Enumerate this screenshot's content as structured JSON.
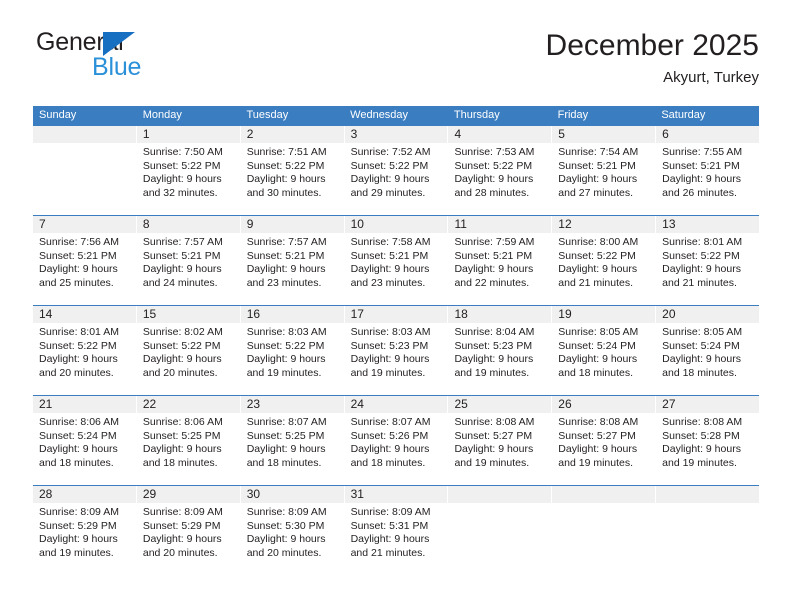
{
  "brand": {
    "name_part1": "General",
    "name_part2": "Blue",
    "accent_color": "#176fc1",
    "blue_text_color": "#2a90d8"
  },
  "header": {
    "title": "December 2025",
    "subtitle": "Akyurt, Turkey"
  },
  "theme": {
    "header_row_bg": "#3a7dc0",
    "day_number_bg": "#f0f0f0",
    "grid_line": "#3a7dc0",
    "text": "#231f20"
  },
  "weekdays": [
    "Sunday",
    "Monday",
    "Tuesday",
    "Wednesday",
    "Thursday",
    "Friday",
    "Saturday"
  ],
  "weeks": [
    [
      {
        "day": "",
        "sunrise": "",
        "sunset": "",
        "daylight": "",
        "empty": true
      },
      {
        "day": "1",
        "sunrise": "Sunrise: 7:50 AM",
        "sunset": "Sunset: 5:22 PM",
        "daylight": "Daylight: 9 hours and 32 minutes."
      },
      {
        "day": "2",
        "sunrise": "Sunrise: 7:51 AM",
        "sunset": "Sunset: 5:22 PM",
        "daylight": "Daylight: 9 hours and 30 minutes."
      },
      {
        "day": "3",
        "sunrise": "Sunrise: 7:52 AM",
        "sunset": "Sunset: 5:22 PM",
        "daylight": "Daylight: 9 hours and 29 minutes."
      },
      {
        "day": "4",
        "sunrise": "Sunrise: 7:53 AM",
        "sunset": "Sunset: 5:22 PM",
        "daylight": "Daylight: 9 hours and 28 minutes."
      },
      {
        "day": "5",
        "sunrise": "Sunrise: 7:54 AM",
        "sunset": "Sunset: 5:21 PM",
        "daylight": "Daylight: 9 hours and 27 minutes."
      },
      {
        "day": "6",
        "sunrise": "Sunrise: 7:55 AM",
        "sunset": "Sunset: 5:21 PM",
        "daylight": "Daylight: 9 hours and 26 minutes."
      }
    ],
    [
      {
        "day": "7",
        "sunrise": "Sunrise: 7:56 AM",
        "sunset": "Sunset: 5:21 PM",
        "daylight": "Daylight: 9 hours and 25 minutes."
      },
      {
        "day": "8",
        "sunrise": "Sunrise: 7:57 AM",
        "sunset": "Sunset: 5:21 PM",
        "daylight": "Daylight: 9 hours and 24 minutes."
      },
      {
        "day": "9",
        "sunrise": "Sunrise: 7:57 AM",
        "sunset": "Sunset: 5:21 PM",
        "daylight": "Daylight: 9 hours and 23 minutes."
      },
      {
        "day": "10",
        "sunrise": "Sunrise: 7:58 AM",
        "sunset": "Sunset: 5:21 PM",
        "daylight": "Daylight: 9 hours and 23 minutes."
      },
      {
        "day": "11",
        "sunrise": "Sunrise: 7:59 AM",
        "sunset": "Sunset: 5:21 PM",
        "daylight": "Daylight: 9 hours and 22 minutes."
      },
      {
        "day": "12",
        "sunrise": "Sunrise: 8:00 AM",
        "sunset": "Sunset: 5:22 PM",
        "daylight": "Daylight: 9 hours and 21 minutes."
      },
      {
        "day": "13",
        "sunrise": "Sunrise: 8:01 AM",
        "sunset": "Sunset: 5:22 PM",
        "daylight": "Daylight: 9 hours and 21 minutes."
      }
    ],
    [
      {
        "day": "14",
        "sunrise": "Sunrise: 8:01 AM",
        "sunset": "Sunset: 5:22 PM",
        "daylight": "Daylight: 9 hours and 20 minutes."
      },
      {
        "day": "15",
        "sunrise": "Sunrise: 8:02 AM",
        "sunset": "Sunset: 5:22 PM",
        "daylight": "Daylight: 9 hours and 20 minutes."
      },
      {
        "day": "16",
        "sunrise": "Sunrise: 8:03 AM",
        "sunset": "Sunset: 5:22 PM",
        "daylight": "Daylight: 9 hours and 19 minutes."
      },
      {
        "day": "17",
        "sunrise": "Sunrise: 8:03 AM",
        "sunset": "Sunset: 5:23 PM",
        "daylight": "Daylight: 9 hours and 19 minutes."
      },
      {
        "day": "18",
        "sunrise": "Sunrise: 8:04 AM",
        "sunset": "Sunset: 5:23 PM",
        "daylight": "Daylight: 9 hours and 19 minutes."
      },
      {
        "day": "19",
        "sunrise": "Sunrise: 8:05 AM",
        "sunset": "Sunset: 5:24 PM",
        "daylight": "Daylight: 9 hours and 18 minutes."
      },
      {
        "day": "20",
        "sunrise": "Sunrise: 8:05 AM",
        "sunset": "Sunset: 5:24 PM",
        "daylight": "Daylight: 9 hours and 18 minutes."
      }
    ],
    [
      {
        "day": "21",
        "sunrise": "Sunrise: 8:06 AM",
        "sunset": "Sunset: 5:24 PM",
        "daylight": "Daylight: 9 hours and 18 minutes."
      },
      {
        "day": "22",
        "sunrise": "Sunrise: 8:06 AM",
        "sunset": "Sunset: 5:25 PM",
        "daylight": "Daylight: 9 hours and 18 minutes."
      },
      {
        "day": "23",
        "sunrise": "Sunrise: 8:07 AM",
        "sunset": "Sunset: 5:25 PM",
        "daylight": "Daylight: 9 hours and 18 minutes."
      },
      {
        "day": "24",
        "sunrise": "Sunrise: 8:07 AM",
        "sunset": "Sunset: 5:26 PM",
        "daylight": "Daylight: 9 hours and 18 minutes."
      },
      {
        "day": "25",
        "sunrise": "Sunrise: 8:08 AM",
        "sunset": "Sunset: 5:27 PM",
        "daylight": "Daylight: 9 hours and 19 minutes."
      },
      {
        "day": "26",
        "sunrise": "Sunrise: 8:08 AM",
        "sunset": "Sunset: 5:27 PM",
        "daylight": "Daylight: 9 hours and 19 minutes."
      },
      {
        "day": "27",
        "sunrise": "Sunrise: 8:08 AM",
        "sunset": "Sunset: 5:28 PM",
        "daylight": "Daylight: 9 hours and 19 minutes."
      }
    ],
    [
      {
        "day": "28",
        "sunrise": "Sunrise: 8:09 AM",
        "sunset": "Sunset: 5:29 PM",
        "daylight": "Daylight: 9 hours and 19 minutes."
      },
      {
        "day": "29",
        "sunrise": "Sunrise: 8:09 AM",
        "sunset": "Sunset: 5:29 PM",
        "daylight": "Daylight: 9 hours and 20 minutes."
      },
      {
        "day": "30",
        "sunrise": "Sunrise: 8:09 AM",
        "sunset": "Sunset: 5:30 PM",
        "daylight": "Daylight: 9 hours and 20 minutes."
      },
      {
        "day": "31",
        "sunrise": "Sunrise: 8:09 AM",
        "sunset": "Sunset: 5:31 PM",
        "daylight": "Daylight: 9 hours and 21 minutes."
      },
      {
        "day": "",
        "sunrise": "",
        "sunset": "",
        "daylight": "",
        "empty": true
      },
      {
        "day": "",
        "sunrise": "",
        "sunset": "",
        "daylight": "",
        "empty": true
      },
      {
        "day": "",
        "sunrise": "",
        "sunset": "",
        "daylight": "",
        "empty": true
      }
    ]
  ]
}
